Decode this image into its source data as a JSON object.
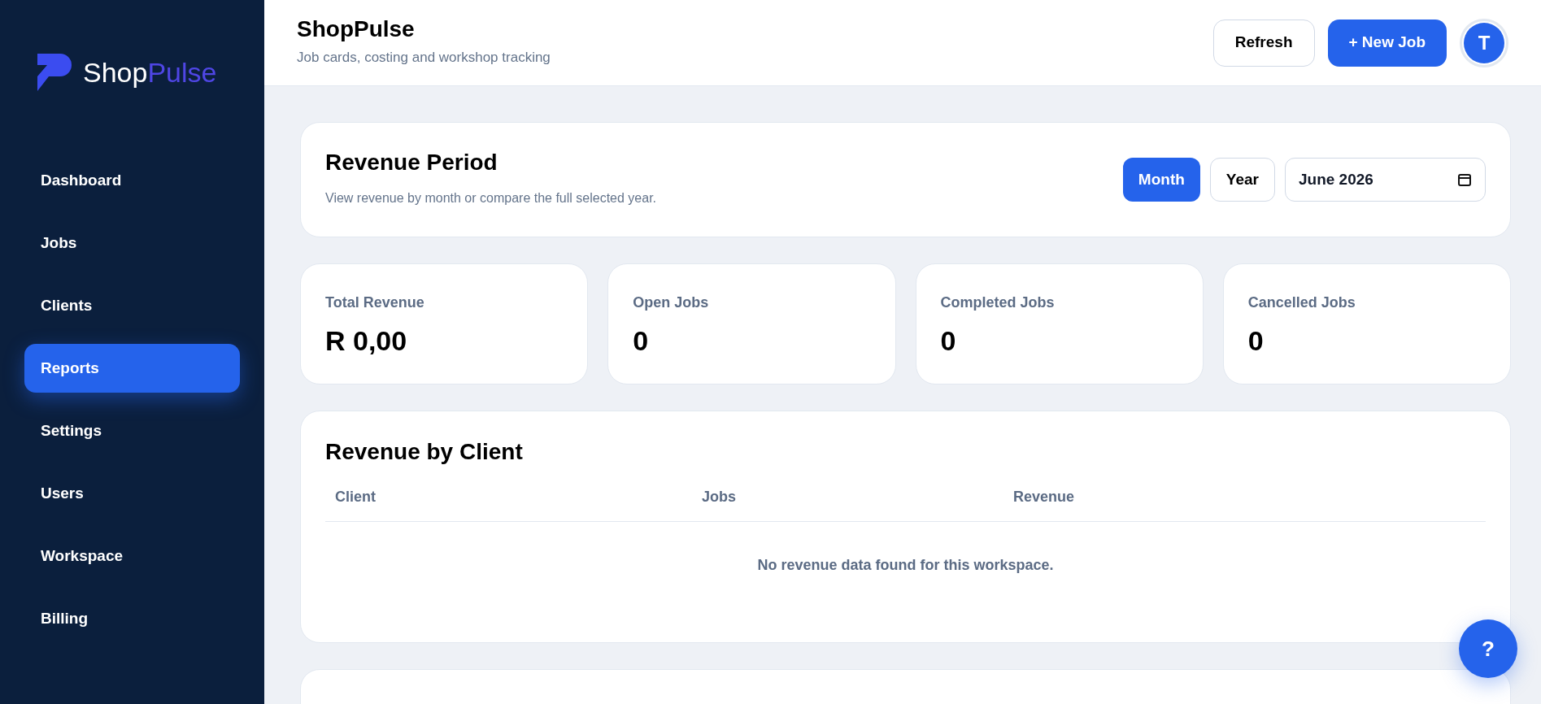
{
  "brand": {
    "name_part_1": "Shop",
    "name_part_2": "Pulse"
  },
  "sidebar": {
    "items": [
      {
        "label": "Dashboard",
        "selected": false
      },
      {
        "label": "Jobs",
        "selected": false
      },
      {
        "label": "Clients",
        "selected": false
      },
      {
        "label": "Reports",
        "selected": true
      },
      {
        "label": "Settings",
        "selected": false
      },
      {
        "label": "Users",
        "selected": false
      },
      {
        "label": "Workspace",
        "selected": false
      },
      {
        "label": "Billing",
        "selected": false
      }
    ]
  },
  "header": {
    "title": "ShopPulse",
    "subtitle": "Job cards, costing and workshop tracking",
    "buttons": [
      {
        "label": "Refresh",
        "kind": "secondary"
      },
      {
        "label": "+ New Job",
        "kind": "primary"
      }
    ],
    "avatar": "T"
  },
  "revenue_period": {
    "title": "Revenue Period",
    "description": "View revenue by month or compare the full selected year.",
    "toggles": [
      {
        "label": "Month",
        "selected": true
      },
      {
        "label": "Year",
        "selected": false
      }
    ],
    "date_value": "June 2026"
  },
  "stats": [
    {
      "label": "Total Revenue",
      "value": "R 0,00"
    },
    {
      "label": "Open Jobs",
      "value": "0"
    },
    {
      "label": "Completed Jobs",
      "value": "0"
    },
    {
      "label": "Cancelled Jobs",
      "value": "0"
    }
  ],
  "revenue_by_client": {
    "title": "Revenue by Client",
    "columns": [
      "Client",
      "Jobs",
      "Revenue"
    ],
    "empty_message": "No revenue data found for this workspace."
  },
  "help_button": "?"
}
